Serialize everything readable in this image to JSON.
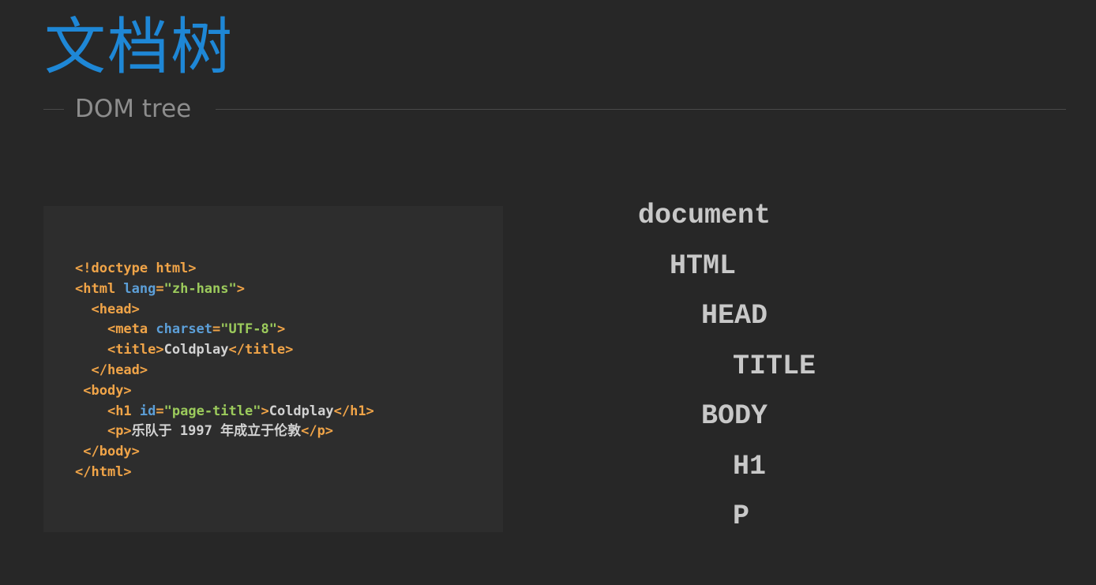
{
  "header": {
    "title": "文档树",
    "subtitle": "DOM tree"
  },
  "code": {
    "lines": [
      [
        {
          "t": "tag",
          "v": "<!doctype html>"
        }
      ],
      [
        {
          "t": "tag",
          "v": "<html "
        },
        {
          "t": "attr",
          "v": "lang"
        },
        {
          "t": "eq",
          "v": "="
        },
        {
          "t": "str",
          "v": "\"zh-hans\""
        },
        {
          "t": "tag",
          "v": ">"
        }
      ],
      [
        {
          "t": "txt",
          "v": "  "
        },
        {
          "t": "tag",
          "v": "<head>"
        }
      ],
      [
        {
          "t": "txt",
          "v": "    "
        },
        {
          "t": "tag",
          "v": "<meta "
        },
        {
          "t": "attr",
          "v": "charset"
        },
        {
          "t": "eq",
          "v": "="
        },
        {
          "t": "str",
          "v": "\"UTF-8\""
        },
        {
          "t": "tag",
          "v": ">"
        }
      ],
      [
        {
          "t": "txt",
          "v": "    "
        },
        {
          "t": "tag",
          "v": "<title>"
        },
        {
          "t": "txt",
          "v": "Coldplay"
        },
        {
          "t": "tag",
          "v": "</title>"
        }
      ],
      [
        {
          "t": "txt",
          "v": "  "
        },
        {
          "t": "tag",
          "v": "</head>"
        }
      ],
      [
        {
          "t": "txt",
          "v": " "
        },
        {
          "t": "tag",
          "v": "<body>"
        }
      ],
      [
        {
          "t": "txt",
          "v": "    "
        },
        {
          "t": "tag",
          "v": "<h1 "
        },
        {
          "t": "attr",
          "v": "id"
        },
        {
          "t": "eq",
          "v": "="
        },
        {
          "t": "str",
          "v": "\"page-title\""
        },
        {
          "t": "tag",
          "v": ">"
        },
        {
          "t": "txt",
          "v": "Coldplay"
        },
        {
          "t": "tag",
          "v": "</h1>"
        }
      ],
      [
        {
          "t": "txt",
          "v": "    "
        },
        {
          "t": "tag",
          "v": "<p>"
        },
        {
          "t": "txt",
          "v": "乐队于 1997 年成立于伦敦"
        },
        {
          "t": "tag",
          "v": "</p>"
        }
      ],
      [
        {
          "t": "txt",
          "v": " "
        },
        {
          "t": "tag",
          "v": "</body>"
        }
      ],
      [
        {
          "t": "tag",
          "v": "</html>"
        }
      ]
    ]
  },
  "tree": {
    "nodes": [
      "document",
      "HTML",
      "HEAD",
      "TITLE",
      "BODY",
      "H1",
      "P"
    ],
    "depths": [
      0,
      1,
      2,
      3,
      2,
      3,
      3
    ]
  },
  "colors": {
    "background": "#272727",
    "title": "#1e87d6",
    "subtitle": "#8d8d8d",
    "code_panel": "#2d2d2d",
    "tag": "#f0a448",
    "attribute": "#5c9fd8",
    "string": "#9ccb5c",
    "text": "#d2d2d2",
    "tree_text": "#c8c8c8"
  }
}
